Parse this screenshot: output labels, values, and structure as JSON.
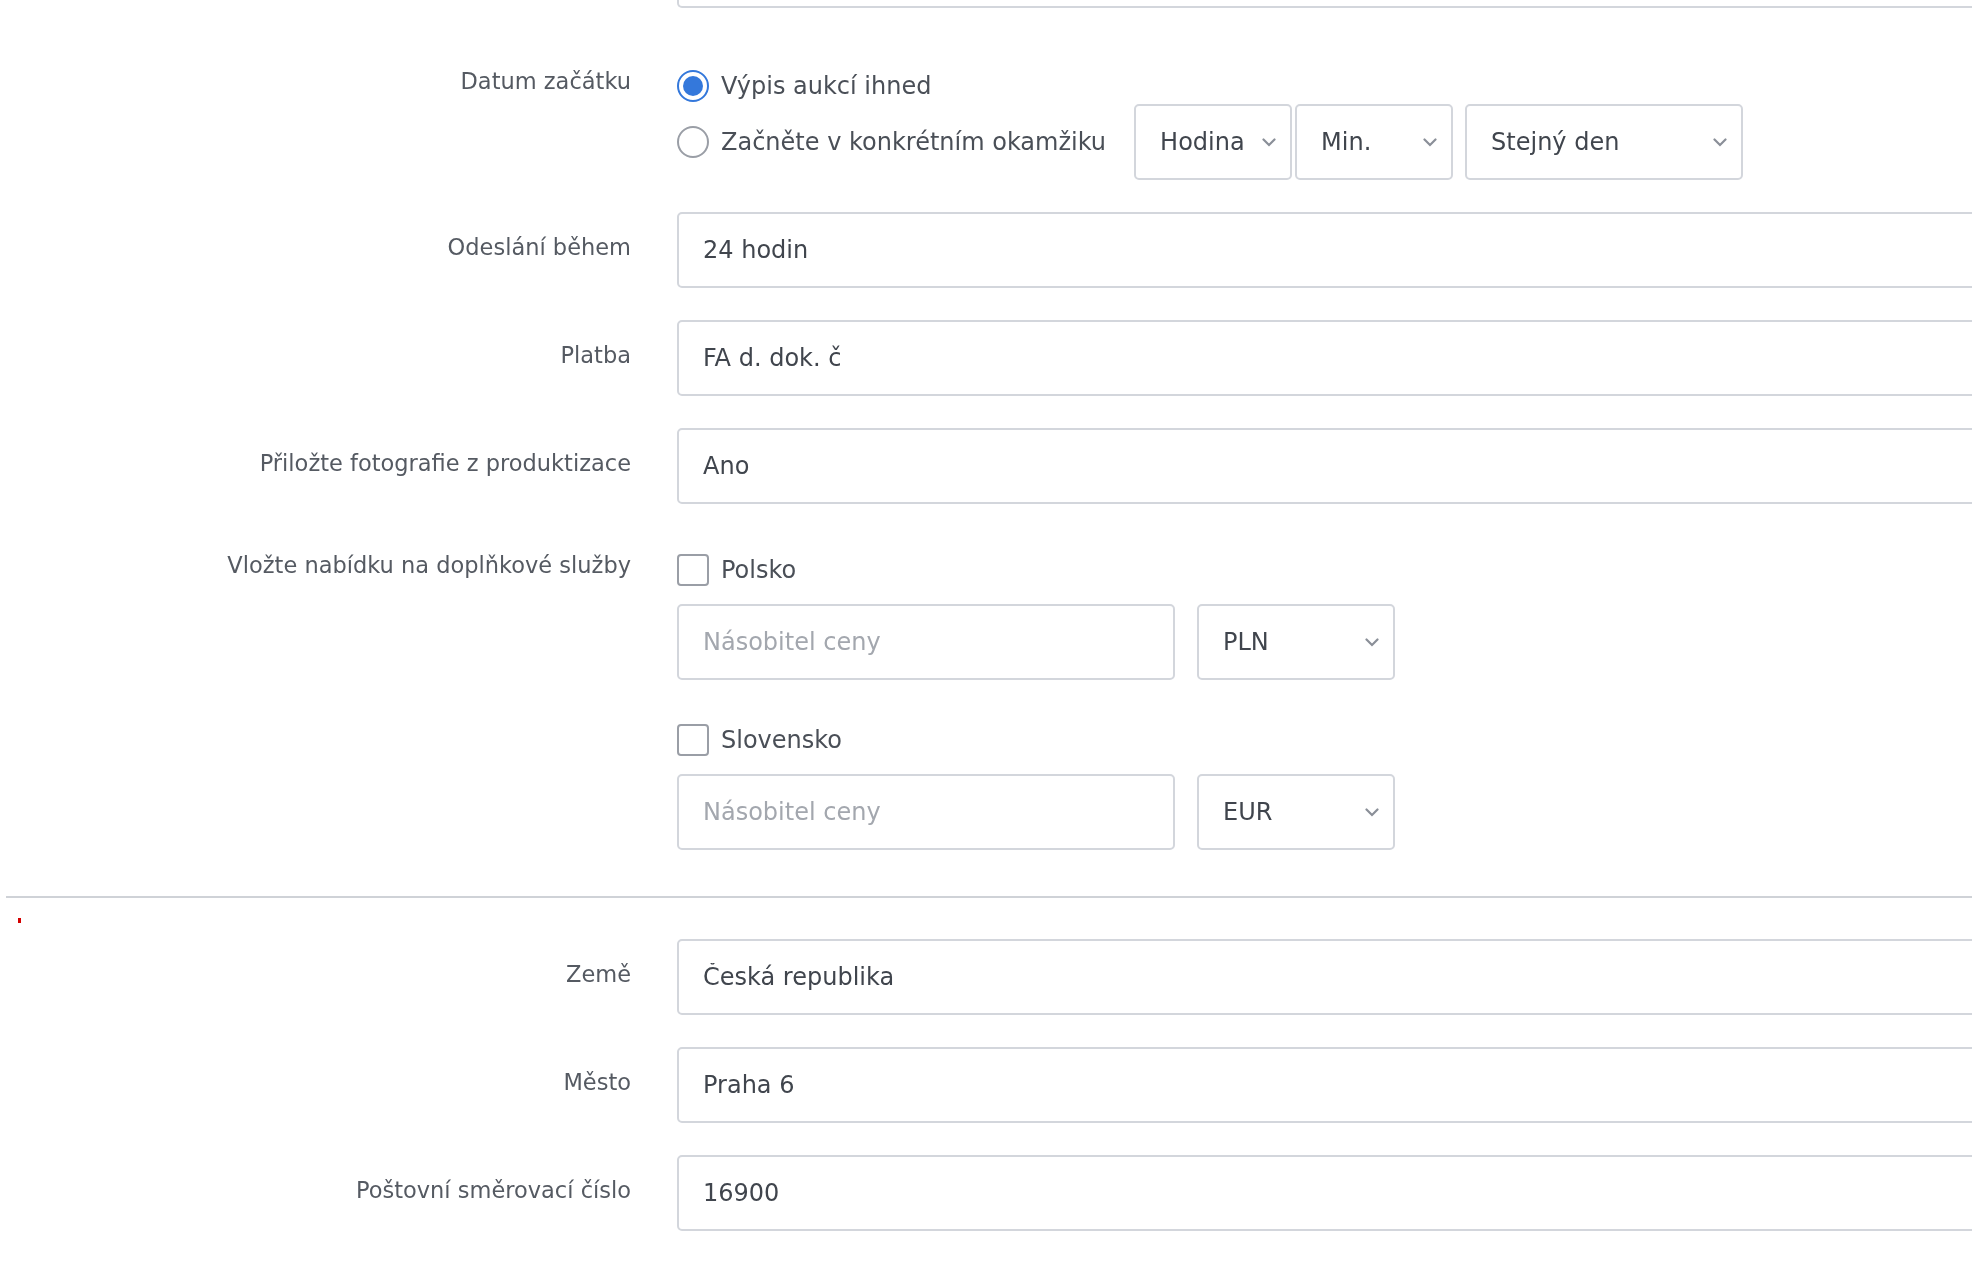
{
  "start_date": {
    "label": "Datum začátku",
    "options": [
      {
        "label": "Výpis aukcí ihned",
        "selected": true
      },
      {
        "label": "Začněte v konkrétním okamžiku",
        "selected": false
      }
    ],
    "selects": [
      {
        "value": "Hodina"
      },
      {
        "value": "Min."
      },
      {
        "value": "Stejný den"
      }
    ]
  },
  "fields": [
    {
      "label": "Odeslání během",
      "value": "24 hodin"
    },
    {
      "label": "Platba",
      "value": "FA d. dok. č"
    },
    {
      "label": "Přiložte fotografie z produktizace",
      "value": "Ano"
    }
  ],
  "extra_services": {
    "label": "Vložte nabídku na doplňkové služby",
    "items": [
      {
        "label": "Polsko",
        "checked": false,
        "placeholder": "Násobitel ceny",
        "currency": "PLN"
      },
      {
        "label": "Slovensko",
        "checked": false,
        "placeholder": "Násobitel ceny",
        "currency": "EUR"
      }
    ]
  },
  "address_fields": [
    {
      "label": "Země",
      "value": "Česká republika"
    },
    {
      "label": "Město",
      "value": "Praha 6"
    },
    {
      "label": "Poštovní směrovací číslo",
      "value": "16900"
    }
  ]
}
